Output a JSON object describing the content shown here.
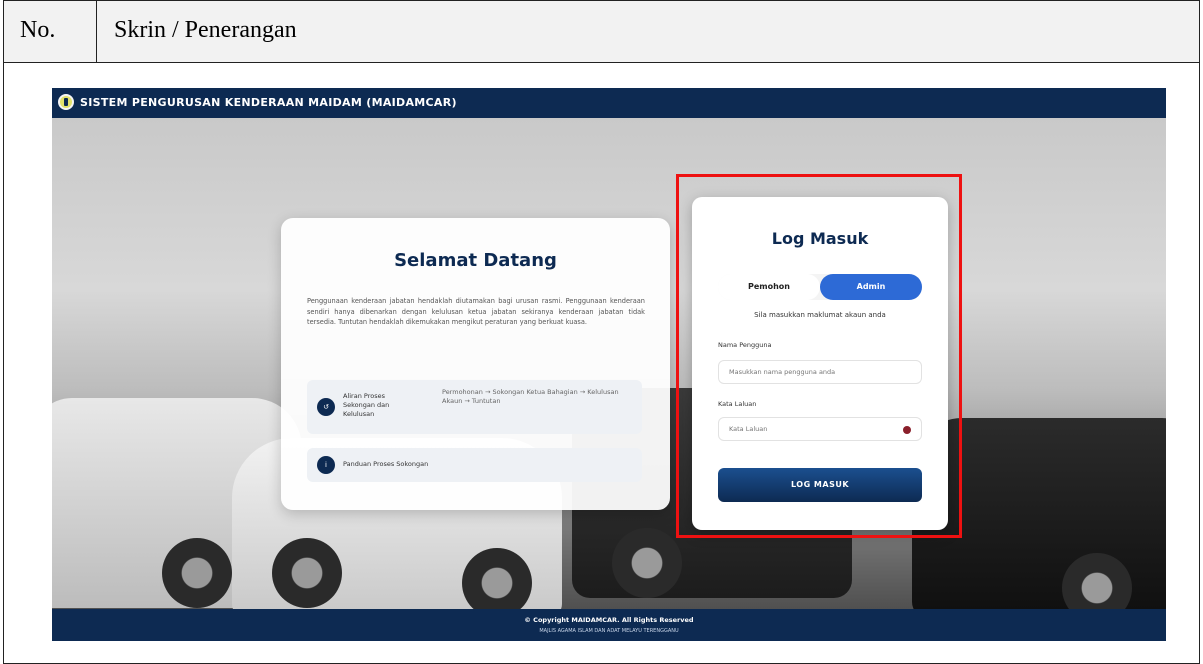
{
  "doc_header": {
    "no_label": "No.",
    "desc_label": "Skrin / Penerangan"
  },
  "topbar": {
    "title": "SISTEM PENGURUSAN KENDERAAN MAIDAM (MAIDAMCAR)",
    "logo_icon": "maidam-logo-icon"
  },
  "welcome": {
    "title": "Selamat Datang",
    "text": "Penggunaan kenderaan jabatan hendaklah diutamakan bagi urusan rasmi. Penggunaan kenderaan sendiri hanya dibenarkan dengan kelulusan ketua jabatan sekiranya kenderaan jabatan tidak tersedia. Tuntutan hendaklah dikemukakan mengikut peraturan yang berkuat kuasa.",
    "rows": [
      {
        "icon": "flow-icon",
        "label": "Aliran Proses Sekongan dan Kelulusan",
        "value": "Permohonan → Sokongan Ketua Bahagian → Kelulusan Akaun → Tuntutan"
      },
      {
        "icon": "info-icon",
        "label": "Panduan Proses Sokongan"
      }
    ]
  },
  "login": {
    "title": "Log Masuk",
    "tabs": [
      "Pemohon",
      "Admin"
    ],
    "active_tab": "Admin",
    "subtitle": "Sila masukkan maklumat akaun anda",
    "username_label": "Nama Pengguna",
    "username_placeholder": "Masukkan nama pengguna anda",
    "password_label": "Kata Laluan",
    "password_placeholder": "Kata Laluan",
    "submit_label": "LOG MASUK"
  },
  "footer": {
    "copyright": "© Copyright MAIDAMCAR. All Rights Reserved",
    "org": "MAJLIS AGAMA ISLAM DAN ADAT MELAYU TERENGGANU"
  },
  "colors": {
    "navy": "#0d2a52",
    "accent": "#2d6ad6",
    "highlight": "#ee1111"
  }
}
